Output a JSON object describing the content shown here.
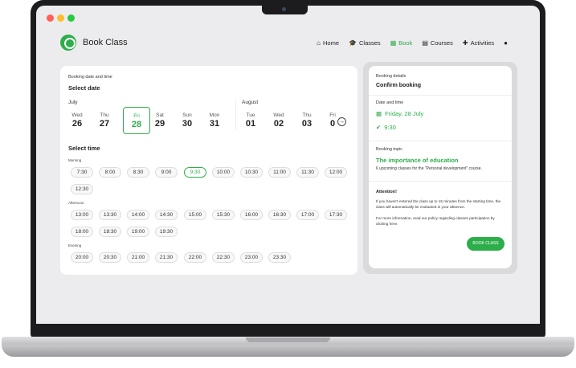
{
  "app": {
    "title": "Book Class"
  },
  "nav": {
    "items": [
      {
        "label": "Home",
        "icon": "home-icon"
      },
      {
        "label": "Classes",
        "icon": "graduation-cap-icon"
      },
      {
        "label": "Book",
        "icon": "calendar-icon"
      },
      {
        "label": "Courses",
        "icon": "book-icon"
      },
      {
        "label": "Activities",
        "icon": "puzzle-icon"
      }
    ],
    "account_icon": "user-icon"
  },
  "booking": {
    "section_label": "Booking date and time",
    "select_date": "Select date",
    "months": [
      "July",
      "August"
    ],
    "days": [
      {
        "name": "Wed",
        "num": "26"
      },
      {
        "name": "Thu",
        "num": "27"
      },
      {
        "name": "Fri",
        "num": "28"
      },
      {
        "name": "Sat",
        "num": "29"
      },
      {
        "name": "Sun",
        "num": "30"
      },
      {
        "name": "Mon",
        "num": "31"
      },
      {
        "name": "Tue",
        "num": "01"
      },
      {
        "name": "Wed",
        "num": "02"
      },
      {
        "name": "Thu",
        "num": "03"
      },
      {
        "name": "Fri",
        "num": "0"
      }
    ],
    "selected_day": "28",
    "select_time": "Select time",
    "groups": [
      {
        "label": "Morning",
        "times": [
          "7:30",
          "8:00",
          "8:30",
          "9:00",
          "9:30",
          "10:00",
          "10:30",
          "11:00",
          "11:30",
          "12:00",
          "12:30"
        ]
      },
      {
        "label": "Afternoon",
        "times": [
          "13:00",
          "13:30",
          "14:00",
          "14:30",
          "15:00",
          "15:30",
          "16:00",
          "16:30",
          "17:00",
          "17:30",
          "18:00",
          "18:30",
          "19:00",
          "19:30"
        ]
      },
      {
        "label": "Evening",
        "times": [
          "20:00",
          "20:30",
          "21:00",
          "21:30",
          "22:00",
          "22:30",
          "23:00",
          "23:30"
        ]
      }
    ],
    "selected_time": "9:30"
  },
  "details": {
    "label": "Booking details",
    "title": "Confirm booking",
    "datetime_label": "Date and time",
    "date": "Friday, 28 July",
    "time": "9:30",
    "topic_label": "Booking topic",
    "topic": "The importance of education",
    "topic_note": "6 upcoming classes for the \"Personal development\" course.",
    "attention_title": "Attention!",
    "attention_p1": "If you haven't entered the class up to 15 minutes from the starting time, the class will automatically be evaluated in your absence.",
    "attention_p2": "For more information, read our policy regarding classes participation by clicking here.",
    "button": "BOOK CLASS"
  },
  "colors": {
    "accent": "#2dae4a"
  }
}
